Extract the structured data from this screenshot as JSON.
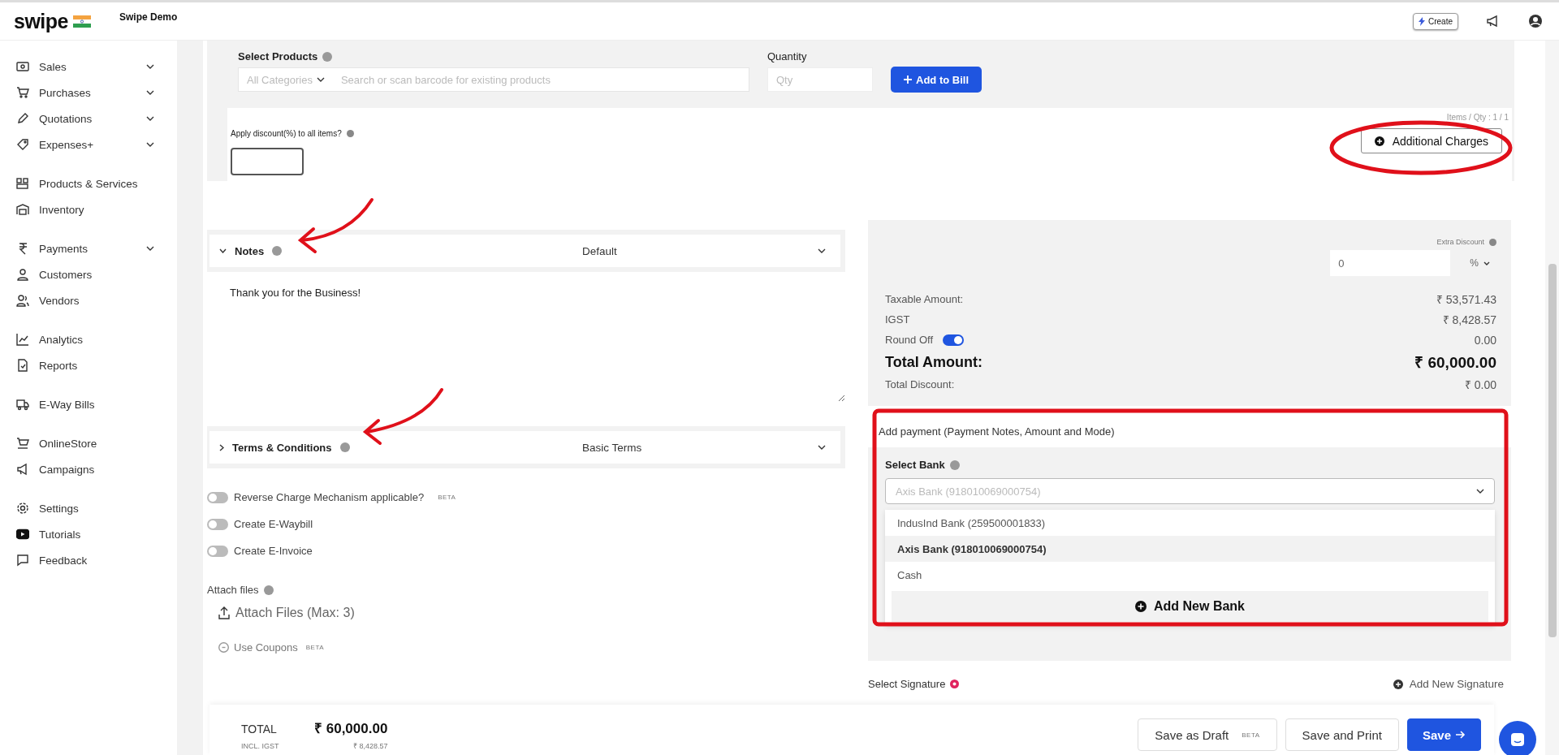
{
  "header": {
    "logo": "swipe",
    "company": "Swipe Demo",
    "create_button": "Create"
  },
  "sidebar": {
    "groups": [
      [
        {
          "label": "Sales",
          "has_submenu": true
        },
        {
          "label": "Purchases",
          "has_submenu": true
        },
        {
          "label": "Quotations",
          "has_submenu": true
        },
        {
          "label": "Expenses+",
          "has_submenu": true
        }
      ],
      [
        {
          "label": "Products & Services",
          "has_submenu": false
        },
        {
          "label": "Inventory",
          "has_submenu": false
        }
      ],
      [
        {
          "label": "Payments",
          "has_submenu": true
        },
        {
          "label": "Customers",
          "has_submenu": false
        },
        {
          "label": "Vendors",
          "has_submenu": false
        }
      ],
      [
        {
          "label": "Analytics",
          "has_submenu": false
        },
        {
          "label": "Reports",
          "has_submenu": false
        }
      ],
      [
        {
          "label": "E-Way Bills",
          "has_submenu": false
        }
      ],
      [
        {
          "label": "OnlineStore",
          "has_submenu": false
        },
        {
          "label": "Campaigns",
          "has_submenu": false
        }
      ],
      [
        {
          "label": "Settings",
          "has_submenu": false
        },
        {
          "label": "Tutorials",
          "has_submenu": false
        },
        {
          "label": "Feedback",
          "has_submenu": false
        }
      ]
    ]
  },
  "products": {
    "label": "Select Products",
    "category": "All Categories",
    "search_placeholder": "Search or scan barcode for existing products",
    "quantity_label": "Quantity",
    "quantity_placeholder": "Qty",
    "add_button": "Add to Bill"
  },
  "discount": {
    "label": "Apply discount(%) to all items?",
    "items_count": "Items / Qty : 1 / 1",
    "additional_charges": "Additional Charges"
  },
  "notes": {
    "title": "Notes",
    "expanded": true,
    "template": "Default",
    "text": "Thank you for the Business!"
  },
  "terms": {
    "title": "Terms & Conditions",
    "expanded": false,
    "template": "Basic Terms"
  },
  "toggles": [
    {
      "label": "Reverse Charge Mechanism applicable?",
      "badge": "BETA",
      "on": false
    },
    {
      "label": "Create E-Waybill",
      "on": false
    },
    {
      "label": "Create E-Invoice",
      "on": false
    }
  ],
  "attach": {
    "label": "Attach files",
    "button": "Attach Files (Max: 3)"
  },
  "coupons": {
    "label": "Use Coupons",
    "badge": "BETA"
  },
  "summary": {
    "extra_discount_label": "Extra Discount",
    "extra_discount_value": "0",
    "unit": "%",
    "rows": [
      {
        "kind": "plain",
        "label": "Taxable Amount:",
        "value": "₹ 53,571.43"
      },
      {
        "kind": "plain",
        "label": "IGST",
        "value": "₹ 8,428.57"
      },
      {
        "kind": "toggle",
        "label": "Round Off",
        "on": true,
        "value": "0.00"
      },
      {
        "kind": "total",
        "label": "Total Amount:",
        "value": "₹ 60,000.00"
      },
      {
        "kind": "plain",
        "label": "Total Discount:",
        "value": "₹ 0.00"
      }
    ]
  },
  "payment": {
    "title": "Add payment (Payment Notes, Amount and Mode)",
    "bank_label": "Select Bank",
    "bank_value": "Axis Bank (918010069000754)",
    "options": [
      {
        "label": "IndusInd Bank (259500001833)",
        "selected": false
      },
      {
        "label": "Axis Bank (918010069000754)",
        "selected": true
      },
      {
        "label": "Cash",
        "selected": false
      }
    ],
    "add_bank": "Add New Bank"
  },
  "signature": {
    "label": "Select Signature",
    "add_button": "Add New Signature"
  },
  "footer": {
    "total_label": "TOTAL",
    "total": "₹ 60,000.00",
    "tax_label": "INCL. IGST",
    "tax": "₹ 8,428.57",
    "buttons": [
      {
        "kind": "outline",
        "label": "Save as Draft",
        "badge": "BETA"
      },
      {
        "kind": "outline",
        "label": "Save and Print"
      },
      {
        "kind": "primary",
        "label": "Save"
      }
    ]
  }
}
